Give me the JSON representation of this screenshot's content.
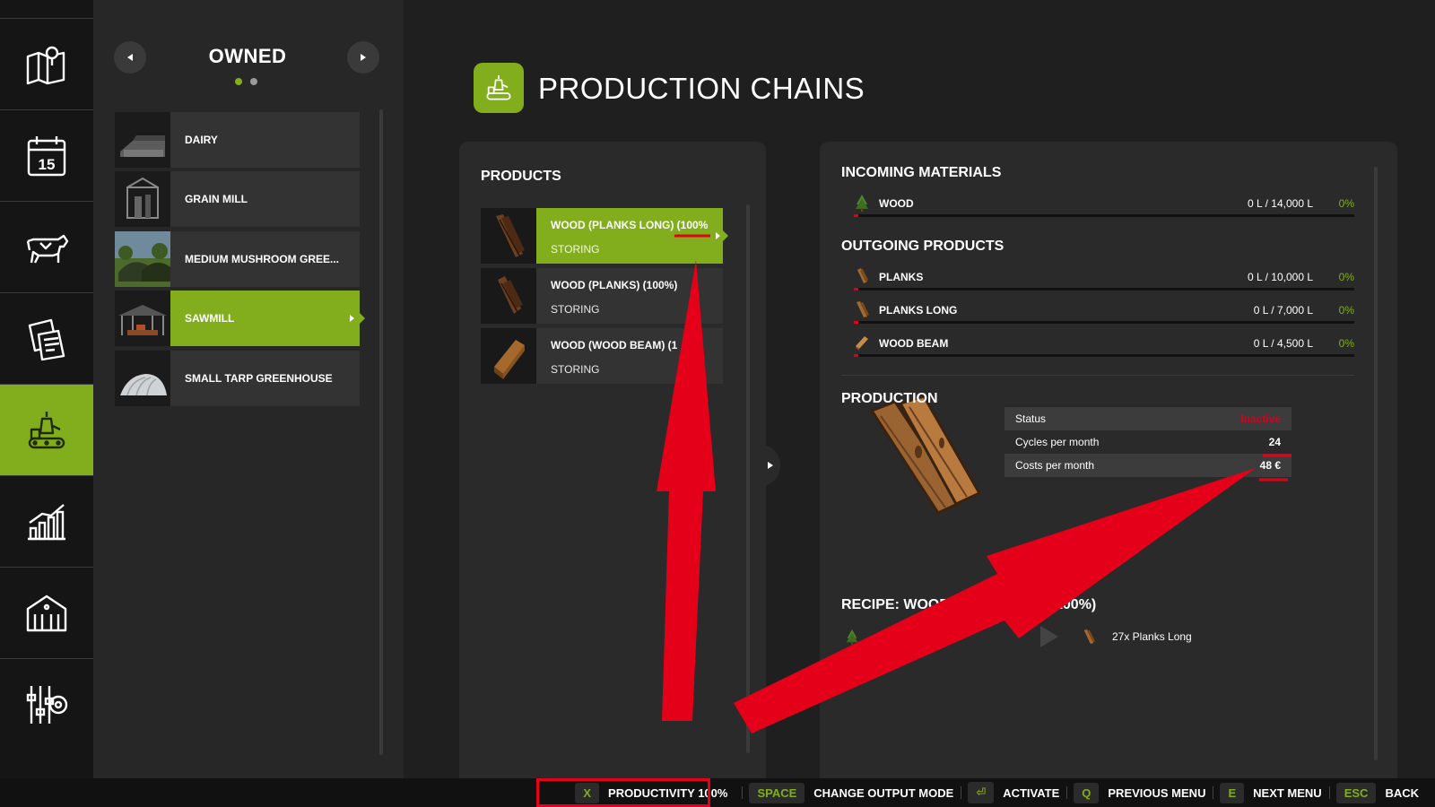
{
  "sidebar": {
    "items": [
      {
        "icon": "map-icon"
      },
      {
        "icon": "calendar-icon",
        "text": "15"
      },
      {
        "icon": "cow-icon"
      },
      {
        "icon": "contracts-icon"
      },
      {
        "icon": "production-icon",
        "active": true
      },
      {
        "icon": "statistics-icon"
      },
      {
        "icon": "barn-icon"
      },
      {
        "icon": "settings-icon"
      }
    ]
  },
  "owned": {
    "title": "OWNED",
    "page_index": 1,
    "page_count": 2,
    "facilities": [
      {
        "label": "DAIRY",
        "active": false
      },
      {
        "label": "GRAIN MILL",
        "active": false
      },
      {
        "label": "MEDIUM MUSHROOM GREE...",
        "active": false
      },
      {
        "label": "SAWMILL",
        "active": true
      },
      {
        "label": "SMALL TARP GREENHOUSE",
        "active": false
      }
    ]
  },
  "header": {
    "title": "PRODUCTION CHAINS"
  },
  "products": {
    "title": "PRODUCTS",
    "items": [
      {
        "name": "WOOD (PLANKS LONG) (100%",
        "state": "STORING",
        "active": true
      },
      {
        "name": "WOOD (PLANKS) (100%)",
        "state": "STORING",
        "active": false
      },
      {
        "name": "WOOD (WOOD BEAM) (1",
        "name_end": ")",
        "state": "STORING",
        "active": false
      }
    ]
  },
  "details": {
    "incoming_title": "INCOMING MATERIALS",
    "incoming": [
      {
        "name": "WOOD",
        "amount": "0 L / 14,000 L",
        "percent": "0%",
        "fill": 0,
        "icon": "tree-icon"
      }
    ],
    "outgoing_title": "OUTGOING PRODUCTS",
    "outgoing": [
      {
        "name": "PLANKS",
        "amount": "0 L / 10,000 L",
        "percent": "0%",
        "fill": 0,
        "icon": "planks-icon"
      },
      {
        "name": "PLANKS LONG",
        "amount": "0 L / 7,000 L",
        "percent": "0%",
        "fill": 0,
        "icon": "planks-long-icon"
      },
      {
        "name": "WOOD BEAM",
        "amount": "0 L / 4,500 L",
        "percent": "0%",
        "fill": 0,
        "icon": "wood-beam-icon"
      }
    ],
    "production_title": "PRODUCTION",
    "stats": [
      {
        "label": "Status",
        "value": "Inactive"
      },
      {
        "label": "Cycles per month",
        "value": "24"
      },
      {
        "label": "Costs per month",
        "value": "48 €"
      }
    ],
    "recipe_title_left": "RECIPE: WOOD",
    "recipe_title_right": "NG) (100%)",
    "recipe_output": "27x Planks Long"
  },
  "bottom_hints": [
    {
      "key": "X",
      "label": "PRODUCTIVITY 100%"
    },
    {
      "key": "SPACE",
      "label": "CHANGE OUTPUT MODE"
    },
    {
      "key": "⏎",
      "label": "ACTIVATE"
    },
    {
      "key": "Q",
      "label": "PREVIOUS MENU"
    },
    {
      "key": "E",
      "label": "NEXT MENU"
    },
    {
      "key": "ESC",
      "label": "BACK"
    }
  ],
  "colors": {
    "accent": "#82ae1d",
    "alert": "#d8001c",
    "annotation": "#e5001a"
  }
}
